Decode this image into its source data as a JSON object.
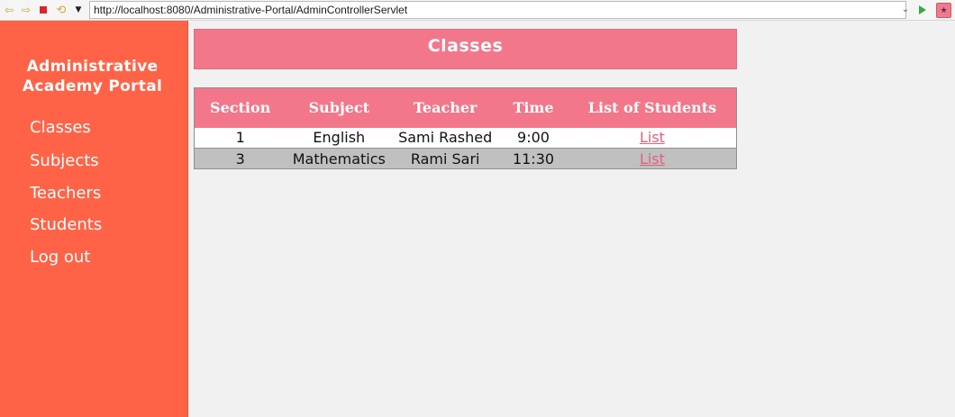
{
  "browser": {
    "url": "http://localhost:8080/Administrative-Portal/AdminControllerServlet",
    "icons": [
      "back-arrow-icon",
      "forward-arrow-icon",
      "stop-icon",
      "refresh-icon",
      "menu-dropdown-icon",
      "url-dropdown-icon",
      "go-icon",
      "extension-icon"
    ]
  },
  "sidebar": {
    "brand_line1": "Administrative",
    "brand_line2": "Academy Portal",
    "items": [
      {
        "label": "Classes"
      },
      {
        "label": "Subjects"
      },
      {
        "label": "Teachers"
      },
      {
        "label": "Students"
      },
      {
        "label": "Log out"
      }
    ]
  },
  "main": {
    "title": "Classes",
    "table": {
      "headers": [
        "Section",
        "Subject",
        "Teacher",
        "Time",
        "List of Students"
      ],
      "rows": [
        {
          "section": "1",
          "subject": "English",
          "teacher": "Sami Rashed",
          "time": "9:00",
          "link": "List"
        },
        {
          "section": "3",
          "subject": "Mathematics",
          "teacher": "Rami Sari",
          "time": "11:30",
          "link": "List"
        }
      ]
    }
  },
  "colors": {
    "sidebar_bg": "#ff6347",
    "accent_pink": "#f3778a",
    "page_bg": "#f2f1f1",
    "row_alt": "#c0c0c0",
    "link": "#e0607a"
  }
}
